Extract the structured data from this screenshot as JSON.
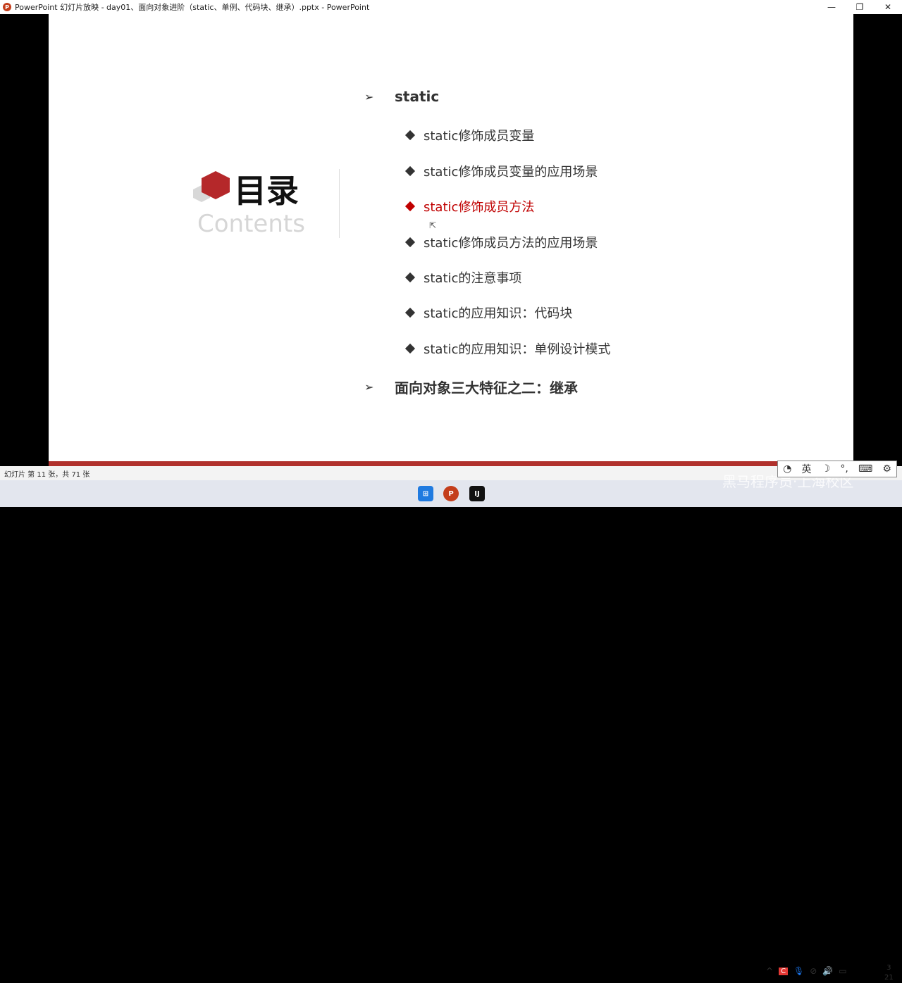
{
  "window": {
    "title": "PowerPoint 幻灯片放映  -  day01、面向对象进阶（static、单例、代码块、继承）.pptx - PowerPoint",
    "minimize": "—",
    "restore": "❐",
    "close": "✕"
  },
  "slide": {
    "heading": "目录",
    "subheading": "Contents",
    "sections": [
      {
        "label": "static",
        "items": [
          "static修饰成员变量",
          "static修饰成员变量的应用场景",
          "static修饰成员方法",
          "static修饰成员方法的应用场景",
          "static的注意事项",
          "static的应用知识：代码块",
          "static的应用知识：单例设计模式"
        ],
        "active_index": 2
      },
      {
        "label": "面向对象三大特征之二：继承"
      }
    ]
  },
  "status": {
    "slide_info": "幻灯片 第 11 张，共 71 张"
  },
  "ime": {
    "lang": "英"
  },
  "watermark": "黑马程序员·上海校区",
  "clock": {
    "line1": "3",
    "line2": "21"
  },
  "colors": {
    "accent": "#c00000",
    "bar": "#b0302c"
  }
}
